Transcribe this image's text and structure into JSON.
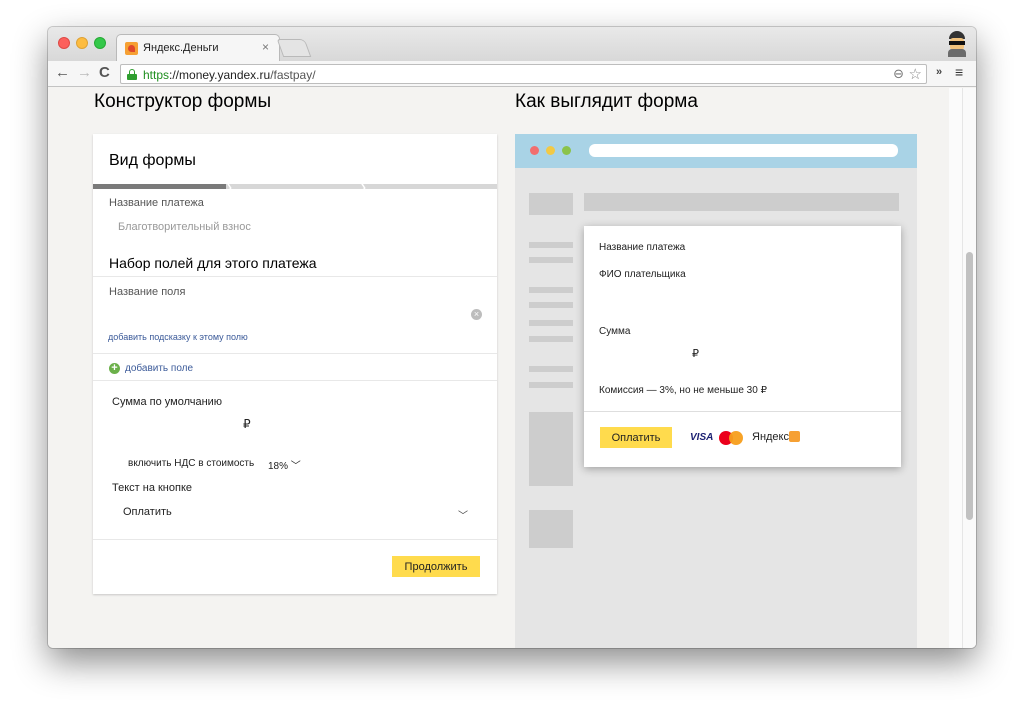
{
  "browser": {
    "tab_title": "Яндекс.Деньги",
    "tab_close": "×",
    "url_scheme": "https",
    "url_host": "://money.yandex.ru",
    "url_path": "/fastpay/",
    "icons": [
      "back-icon",
      "forward-icon",
      "reload-icon",
      "lock-icon",
      "zoom-icon",
      "star-icon",
      "extensions-icon",
      "menu-icon",
      "user-avatar"
    ]
  },
  "left": {
    "heading": "Конструктор формы",
    "card_title": "Вид формы",
    "progress_fraction": 0.33,
    "payment_name_label": "Название платежа",
    "payment_name_value": "Благотворительный взнос",
    "fields_section_title": "Набор полей для этого платежа",
    "field_name_label": "Название поля",
    "hint_link": "добавить подсказку к этому полю",
    "add_field": "добавить поле",
    "default_amount_label": "Сумма по умолчанию",
    "currency": "₽",
    "vat_label": "включить НДС в стоимость",
    "vat_value": "18%",
    "button_text_label": "Текст на кнопке",
    "button_text_value": "Оплатить",
    "continue_button": "Продолжить"
  },
  "right": {
    "heading": "Как выглядит форма",
    "payment_name": "Название платежа",
    "payer_name": "ФИО плательщика",
    "amount_label": "Сумма",
    "currency": "₽",
    "commission": "Комиссия — 3%, но не меньше 30  ₽",
    "pay_button": "Оплатить",
    "visa": "VISA",
    "yandex_brand": "Яндекс"
  },
  "colors": {
    "accent_button": "#ffdb4d",
    "preview_header": "#a9d3e6",
    "link": "#3b5a99",
    "add_icon": "#6bb04a",
    "dot_red": "#f26e6e",
    "dot_yellow": "#f2c945",
    "dot_green": "#8bc34a"
  }
}
